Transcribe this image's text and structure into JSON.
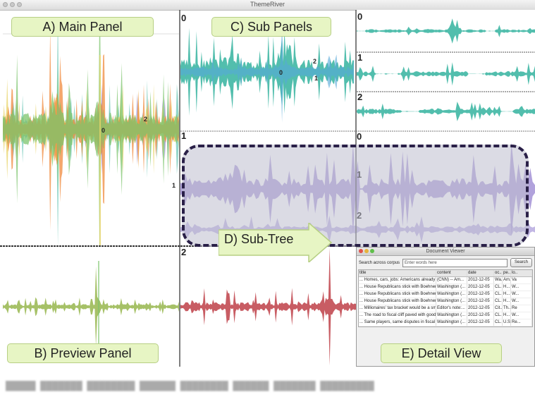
{
  "app": {
    "title": "ThemeRiver"
  },
  "callouts": {
    "main": "A) Main Panel",
    "sub": "C) Sub Panels",
    "subtree": "D) Sub-Tree",
    "preview": "B) Preview Panel",
    "detail": "E) Detail View"
  },
  "panel_numbers": {
    "main_a": "0",
    "main_b": "2",
    "main_c": "1",
    "sub0_a": "0",
    "sub0_b": "2",
    "sub0_c": "1",
    "col_0": "0",
    "col_1": "1",
    "col_2": "2",
    "tree_0": "0",
    "tree_1": "1",
    "tree_2": "2",
    "panel_0": "0",
    "panel_1": "1",
    "panel_2": "2"
  },
  "colors": {
    "main": [
      "#9f8fd0",
      "#6fc8b8",
      "#e8d46a",
      "#f08a3c",
      "#7cc46c"
    ],
    "teal": "#3fb7a4",
    "purple": "#a898d8",
    "preview": "#9cba56",
    "red": "#c24a52"
  },
  "detail_view": {
    "title": "Document Viewer",
    "search_label": "Search across corpus",
    "search_placeholder": "Enter words here",
    "search_button": "Search",
    "columns": [
      "title",
      "content",
      "date",
      "oc..",
      "pe..",
      "lo.."
    ],
    "rows": [
      [
        "... Homes, cars, jobs: Americans already making big de...",
        "(CNN) -- Am...",
        "2012-12-05",
        "Wa...",
        "Am...",
        "Va"
      ],
      [
        "... House Republicans stick with Boehner on fiscal cliff",
        "Washington (...",
        "2012-12-05",
        "CL...",
        "H...",
        "W..."
      ],
      [
        "... House Republicans stick with Boehner on fiscal cliff",
        "Washington (...",
        "2012-12-05",
        "CL...",
        "H...",
        "W..."
      ],
      [
        "... House Republicans stick with Boehner on fiscal cliff",
        "Washington (...",
        "2012-12-05",
        "CL...",
        "H...",
        "W..."
      ],
      [
        "... Millionaires' tax bracket would be a smart compromi...",
        "Editor's note:...",
        "2012-12-05",
        "Cit...",
        "Th...",
        "Re"
      ],
      [
        "... The road to fiscal cliff paved with good intentions",
        "Washington (...",
        "2012-12-05",
        "CL...",
        "H...",
        "W..."
      ],
      [
        "... Same players, same disputes in fiscal cliff debate",
        "Washington (...",
        "2012-12-05",
        "CL...",
        "U.S...",
        "Re..."
      ]
    ]
  }
}
